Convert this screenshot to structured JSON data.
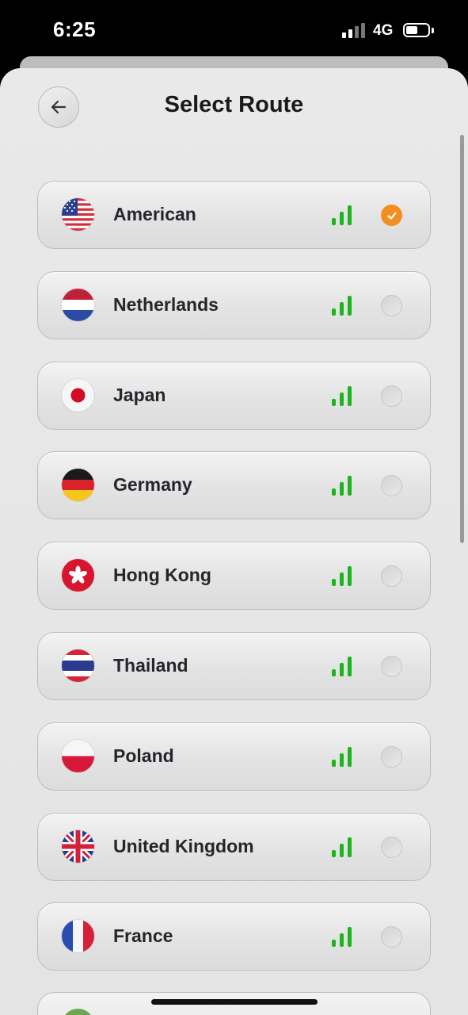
{
  "status_bar": {
    "time": "6:25",
    "network": "4G"
  },
  "header": {
    "title": "Select Route"
  },
  "routes": [
    {
      "name": "American",
      "flag": "us-flag",
      "selected": true
    },
    {
      "name": "Netherlands",
      "flag": "netherlands-flag",
      "selected": false
    },
    {
      "name": "Japan",
      "flag": "japan-flag",
      "selected": false
    },
    {
      "name": "Germany",
      "flag": "germany-flag",
      "selected": false
    },
    {
      "name": "Hong Kong",
      "flag": "hong-kong-flag",
      "selected": false
    },
    {
      "name": "Thailand",
      "flag": "thailand-flag",
      "selected": false
    },
    {
      "name": "Poland",
      "flag": "poland-flag",
      "selected": false
    },
    {
      "name": "United Kingdom",
      "flag": "uk-flag",
      "selected": false
    },
    {
      "name": "France",
      "flag": "france-flag",
      "selected": false
    }
  ],
  "colors": {
    "accent": "#f48e21",
    "signal": "#1cb51e"
  }
}
